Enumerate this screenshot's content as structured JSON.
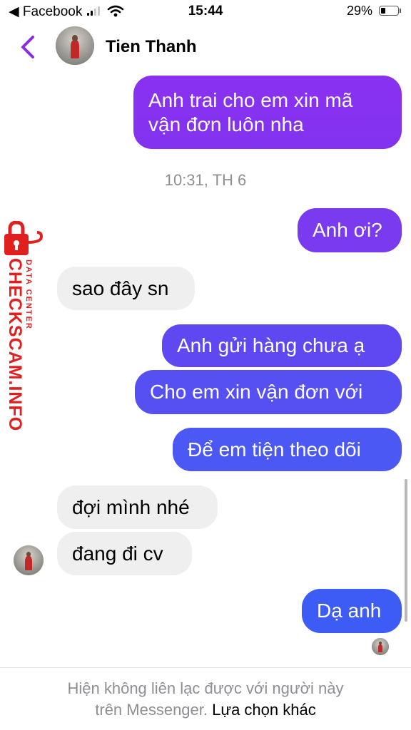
{
  "status_bar": {
    "back_app": "◀ Facebook",
    "time": "15:44",
    "battery": "29%",
    "battery_level": 0.29
  },
  "header": {
    "back_icon": "chevron-left-icon",
    "name": "Tien Thanh"
  },
  "messages": [
    {
      "side": "out",
      "lines": [
        "Anh trai cho em xin mã",
        "vận đơn luôn nha"
      ]
    },
    {
      "side": "out",
      "text": "Anh ơi?"
    },
    {
      "side": "in",
      "text": "sao đây sn"
    },
    {
      "side": "out",
      "text": "Anh gửi hàng chưa ạ"
    },
    {
      "side": "out",
      "text": "Cho em xin vận đơn với"
    },
    {
      "side": "out",
      "text": "Để em tiện theo dõi"
    },
    {
      "side": "in",
      "text": "đợi mình nhé"
    },
    {
      "side": "in",
      "text": "đang đi cv"
    },
    {
      "side": "out",
      "text": "Dạ anh"
    }
  ],
  "timestamp": "10:31, TH 6",
  "watermark": {
    "main": "CHECKSCAM.INFO",
    "sub": "DATA CENTER"
  },
  "footer": {
    "line1": "Hiện không liên lạc được với người này",
    "line2": "trên Messenger.",
    "link": "Lựa chọn khác"
  },
  "colors": {
    "accent": "#8a2be2",
    "bubble_top": "#8a31f0",
    "bubble_bottom": "#3d5cf5",
    "incoming": "#efefef",
    "watermark": "#e0201f"
  }
}
